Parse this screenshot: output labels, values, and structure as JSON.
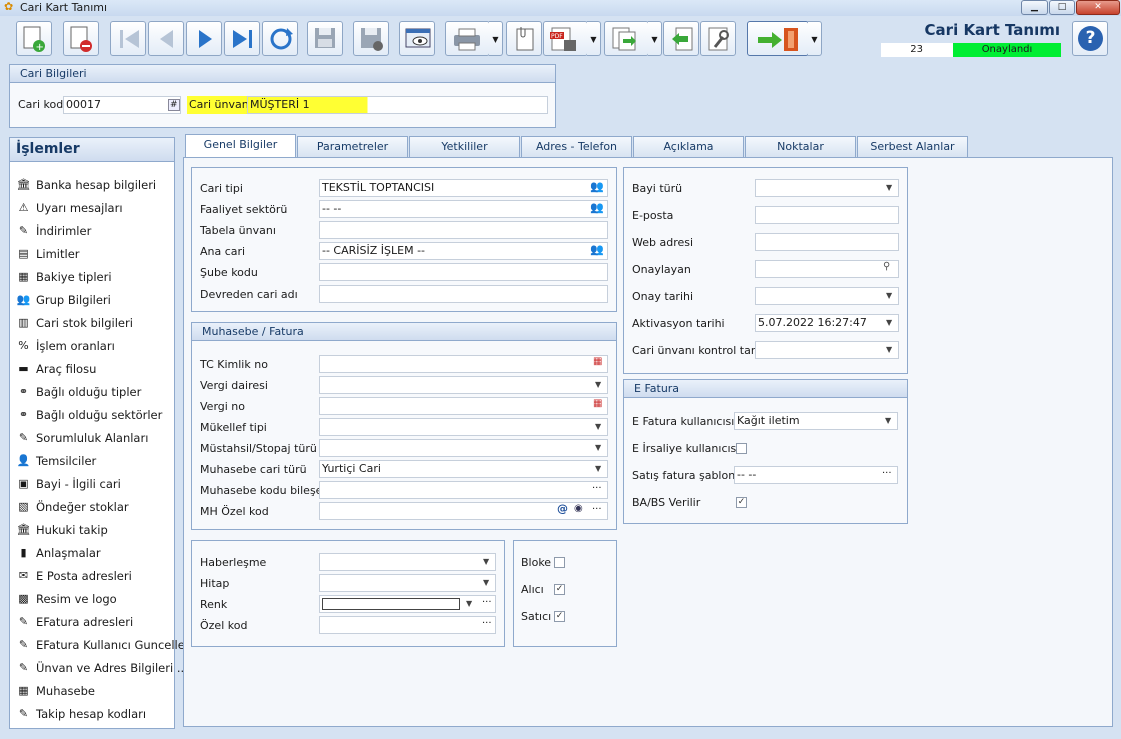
{
  "window": {
    "title": "Cari Kart Tanımı",
    "minimize": "▁",
    "maximize": "□",
    "close": "✕"
  },
  "header": {
    "title": "Cari Kart Tanımı",
    "counter": "23",
    "status": "Onaylandı",
    "help": "?"
  },
  "colors": {
    "accent": "#173a66",
    "status": "#00ee33",
    "highlight": "#ffff33"
  },
  "cari_bilgileri": {
    "title": "Cari Bilgileri",
    "kod_label": "Cari kod",
    "kod_value": "00017",
    "hash": "#",
    "unvan_label": "Cari ünvanı",
    "unvan_value": "MÜŞTERİ 1"
  },
  "sidebar": {
    "title": "İşlemler",
    "items": [
      {
        "label": "Banka hesap bilgileri",
        "icon": "🏛"
      },
      {
        "label": "Uyarı mesajları",
        "icon": "⚠"
      },
      {
        "label": "İndirimler",
        "icon": "✎"
      },
      {
        "label": "Limitler",
        "icon": "▤"
      },
      {
        "label": "Bakiye tipleri",
        "icon": "▦"
      },
      {
        "label": "Grup Bilgileri",
        "icon": "👥"
      },
      {
        "label": "Cari stok bilgileri",
        "icon": "▥"
      },
      {
        "label": "İşlem oranları",
        "icon": "%"
      },
      {
        "label": "Araç filosu",
        "icon": "▬"
      },
      {
        "label": "Bağlı olduğu tipler",
        "icon": "⚭"
      },
      {
        "label": "Bağlı olduğu sektörler",
        "icon": "⚭"
      },
      {
        "label": "Sorumluluk Alanları",
        "icon": "✎"
      },
      {
        "label": "Temsilciler",
        "icon": "👤"
      },
      {
        "label": "Bayi - İlgili cari",
        "icon": "▣"
      },
      {
        "label": "Öndeğer stoklar",
        "icon": "▧"
      },
      {
        "label": "Hukuki takip",
        "icon": "🏛"
      },
      {
        "label": "Anlaşmalar",
        "icon": "▮"
      },
      {
        "label": "E Posta adresleri",
        "icon": "✉"
      },
      {
        "label": "Resim ve logo",
        "icon": "▩"
      },
      {
        "label": "EFatura adresleri",
        "icon": "✎"
      },
      {
        "label": "EFatura Kullanıcı Guncelle",
        "icon": "✎"
      },
      {
        "label": "Ünvan ve Adres Bilgileri ...",
        "icon": "✎"
      },
      {
        "label": "Muhasebe",
        "icon": "▦"
      },
      {
        "label": "Takip hesap kodları",
        "icon": "✎"
      }
    ]
  },
  "tabs": [
    "Genel Bilgiler",
    "Parametreler",
    "Yetkililer",
    "Adres - Telefon",
    "Açıklama",
    "Noktalar",
    "Serbest Alanlar"
  ],
  "genel": {
    "cari_tipi_label": "Cari tipi",
    "cari_tipi_value": "TEKSTİL TOPTANCISI",
    "faaliyet_label": "Faaliyet sektörü",
    "faaliyet_value": "-- --",
    "tabela_label": "Tabela ünvanı",
    "ana_cari_label": "Ana cari",
    "ana_cari_value": "-- CARİSİZ İŞLEM --",
    "sube_label": "Şube kodu",
    "devreden_label": "Devreden cari adı"
  },
  "muhasebe": {
    "title": "Muhasebe / Fatura",
    "tc_label": "TC Kimlik no",
    "vergi_dairesi_label": "Vergi dairesi",
    "vergi_no_label": "Vergi no",
    "mukellef_label": "Mükellef tipi",
    "mustahsil_label": "Müstahsil/Stopaj türü",
    "muh_cari_turu_label": "Muhasebe cari türü",
    "muh_cari_turu_value": "Yurtiçi Cari",
    "muh_kodu_label": "Muhasebe kodu bileşeni",
    "mh_ozel_label": "MH Özel kod",
    "ellipsis": "···",
    "at": "@"
  },
  "haber": {
    "haberlesme_label": "Haberleşme",
    "hitap_label": "Hitap",
    "renk_label": "Renk",
    "ozel_kod_label": "Özel kod"
  },
  "flags": {
    "bloke_label": "Bloke",
    "bloke": false,
    "alici_label": "Alıcı",
    "alici": true,
    "satici_label": "Satıcı",
    "satici": true
  },
  "right": {
    "bayi_turu_label": "Bayi türü",
    "eposta_label": "E-posta",
    "web_label": "Web adresi",
    "onaylayan_label": "Onaylayan",
    "onay_tarihi_label": "Onay tarihi",
    "aktivasyon_label": "Aktivasyon tarihi",
    "aktivasyon_value": "5.07.2022 16:27:47",
    "unvan_kontrol_label": "Cari ünvanı kontrol tarihi"
  },
  "efatura": {
    "title": "E Fatura",
    "kullanici_label": "E Fatura kullanıcısı",
    "kullanici_value": "Kağıt iletim",
    "irsaliye_label": "E İrsaliye kullanıcısı",
    "irsaliye": false,
    "sablon_label": "Satış fatura şablonu",
    "sablon_value": "-- --",
    "babs_label": "BA/BS Verilir",
    "babs": true
  }
}
